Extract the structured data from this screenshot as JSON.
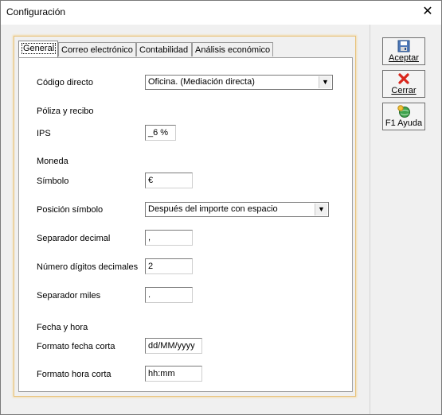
{
  "window": {
    "title": "Configuración"
  },
  "tabs": [
    "General",
    "Correo electrónico",
    "Contabilidad",
    "Análisis económico"
  ],
  "form": {
    "codigo_directo": {
      "label": "Código directo",
      "value": "Oficina. (Mediación directa)"
    },
    "poliza_heading": "Póliza y recibo",
    "ips": {
      "label": "IPS",
      "value": "_6 %"
    },
    "moneda_heading": "Moneda",
    "simbolo": {
      "label": "Símbolo",
      "value": "€"
    },
    "posicion": {
      "label": "Posición símbolo",
      "value": "Después del importe con espacio"
    },
    "sep_decimal": {
      "label": "Separador decimal",
      "value": ","
    },
    "num_decimales": {
      "label": "Número dígitos decimales",
      "value": "2"
    },
    "sep_miles": {
      "label": "Separador miles",
      "value": "."
    },
    "fecha_heading": "Fecha y hora",
    "fecha_corta": {
      "label": "Formato fecha corta",
      "value": "dd/MM/yyyy"
    },
    "hora_corta": {
      "label": "Formato hora corta",
      "value": "hh:mm"
    }
  },
  "buttons": {
    "aceptar": {
      "label": "Aceptar",
      "icon": "save-disk-icon"
    },
    "cerrar": {
      "label": "Cerrar",
      "icon": "red-x-icon"
    },
    "ayuda": {
      "label": "F1 Ayuda",
      "icon": "help-globe-icon"
    }
  },
  "colors": {
    "panel_border": "#e7c27b",
    "close_red": "#d9261c"
  }
}
